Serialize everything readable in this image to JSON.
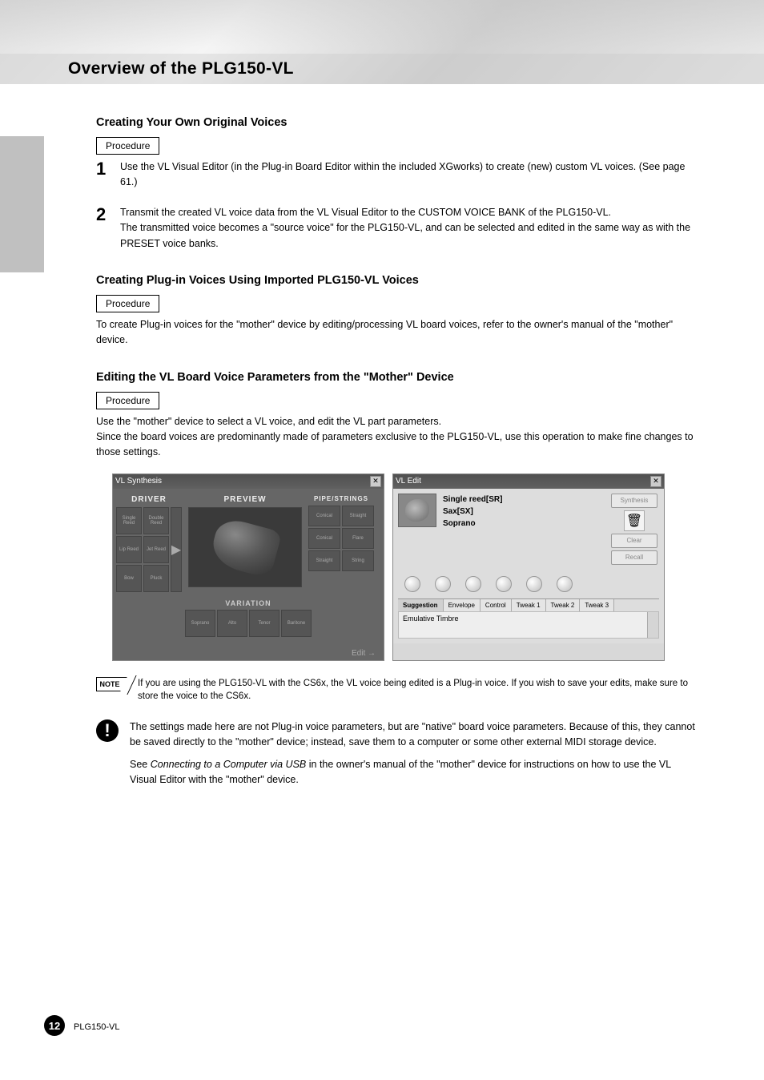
{
  "page_title": "Overview of the PLG150-VL",
  "sections": {
    "creating": {
      "heading": "Creating Your Own Original Voices",
      "box": "Procedure",
      "step1": "Use the VL Visual Editor (in the Plug-in Board Editor within the included XGworks) to create (new) custom VL voices. (See page 61.)",
      "step2": "Transmit the created VL voice data from the VL Visual Editor to the CUSTOM VOICE BANK of the PLG150-VL.",
      "step2_cont": "The transmitted voice becomes a \"source voice\" for the PLG150-VL, and can be selected and edited in the same way as with the PRESET voice banks."
    },
    "plugin_edit": {
      "heading": "Creating Plug-in Voices Using Imported PLG150-VL Voices",
      "box": "Procedure",
      "para": "To create Plug-in voices for the \"mother\" device by editing/processing VL board voices, refer to the owner's manual of the \"mother\" device."
    },
    "board_edit": {
      "heading": "Editing the VL Board Voice Parameters from the \"Mother\" Device",
      "box": "Procedure",
      "para": "Use the \"mother\" device to select a VL voice, and edit the VL part parameters.",
      "para_cont": "Since the board voices are predominantly made of parameters exclusive to the PLG150-VL, use this operation to make fine changes to those settings."
    },
    "screenshot1": {
      "title": "VL Synthesis",
      "driver_label": "DRIVER",
      "preview_label": "PREVIEW",
      "pipe_label": "PIPE/STRINGS",
      "variation_label": "VARIATION",
      "driver_cells": [
        "Single Reed",
        "Double Reed",
        "Lip Reed",
        "Jet Reed",
        "Bow",
        "Pluck"
      ],
      "pipe_cells": [
        "Conical",
        "Straight",
        "Conical",
        "Flare",
        "Straight",
        "String"
      ],
      "var_cells": [
        "Soprano",
        "Alto",
        "Tenor",
        "Baritone"
      ],
      "edit": "Edit"
    },
    "screenshot2": {
      "title": "VL Edit",
      "line1": "Single reed[SR]",
      "line2": "Sax[SX]",
      "line3": "Soprano",
      "synth_btn": "Synthesis",
      "clear_btn": "Clear",
      "recall_btn": "Recall",
      "tabs": [
        "Suggestion",
        "Envelope",
        "Control",
        "Tweak 1",
        "Tweak 2",
        "Tweak 3"
      ],
      "info": "Emulative Timbre"
    },
    "note": {
      "label": "NOTE",
      "text": "If you are using the PLG150-VL with the CS6x, the VL voice being edited is a Plug-in voice. If you wish to save your edits, make sure to store the voice to the CS6x."
    },
    "notice": {
      "text1": "The settings made here are not Plug-in voice parameters, but are \"native\" board voice parameters. Because of this, they cannot be saved directly to the \"mother\" device; instead, save them to a computer or some other external MIDI storage device.",
      "text2_prefix": "See ",
      "text2_link": "Connecting to a Computer via USB",
      "text2_suffix": " in the owner's manual of the \"mother\" device for instructions on how to use the VL Visual Editor with the \"mother\" device."
    },
    "footer": {
      "page_num": "12",
      "text": "PLG150-VL"
    }
  }
}
